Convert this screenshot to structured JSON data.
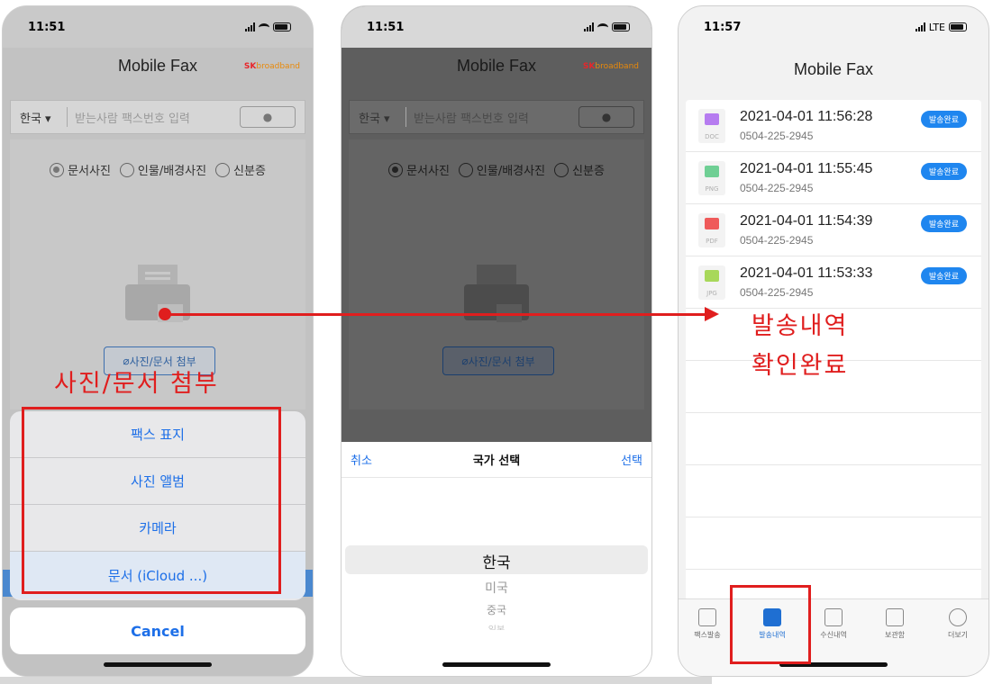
{
  "phone1": {
    "time": "11:51",
    "title": "Mobile Fax",
    "logo_sk": "SK",
    "logo_text": "broadband",
    "country": "한국",
    "recipient_placeholder": "받는사람 팩스번호 입력",
    "radios": [
      "문서사진",
      "인물/배경사진",
      "신분증"
    ],
    "attach_label": "사진/문서 첨부",
    "sheet_items": [
      "팩스 표지",
      "사진 앨범",
      "카메라",
      "문서 (iCloud ...)"
    ],
    "cancel_label": "Cancel"
  },
  "phone2": {
    "time": "11:51",
    "title": "Mobile Fax",
    "logo_sk": "SK",
    "logo_text": "broadband",
    "country": "한국",
    "recipient_placeholder": "받는사람 팩스번호 입력",
    "radios": [
      "문서사진",
      "인물/배경사진",
      "신분증"
    ],
    "attach_label": "사진/문서 첨부",
    "picker_cancel": "취소",
    "picker_title": "국가 선택",
    "picker_ok": "선택",
    "picker_options": [
      "한국",
      "미국",
      "중국",
      "일본"
    ]
  },
  "phone3": {
    "time": "11:57",
    "network": "LTE",
    "title": "Mobile Fax",
    "rows": [
      {
        "ext": "DOC",
        "date": "2021-04-01 11:56:28",
        "number": "0504-225-2945",
        "status": "발송완료",
        "color": "#a855f7"
      },
      {
        "ext": "PNG",
        "date": "2021-04-01 11:55:45",
        "number": "0504-225-2945",
        "status": "발송완료",
        "color": "#4fc27a"
      },
      {
        "ext": "PDF",
        "date": "2021-04-01 11:54:39",
        "number": "0504-225-2945",
        "status": "발송완료",
        "color": "#ef4444"
      },
      {
        "ext": "JPG",
        "date": "2021-04-01 11:53:33",
        "number": "0504-225-2945",
        "status": "발송완료",
        "color": "#9acd32"
      }
    ],
    "tabs": [
      "팩스발송",
      "발송내역",
      "수신내역",
      "보관함",
      "더보기"
    ]
  },
  "annotations": {
    "attach_caption": "사진/문서 첨부",
    "history_line1": "발송내역",
    "history_line2": "확인완료",
    "accent": "#e01e1e"
  }
}
